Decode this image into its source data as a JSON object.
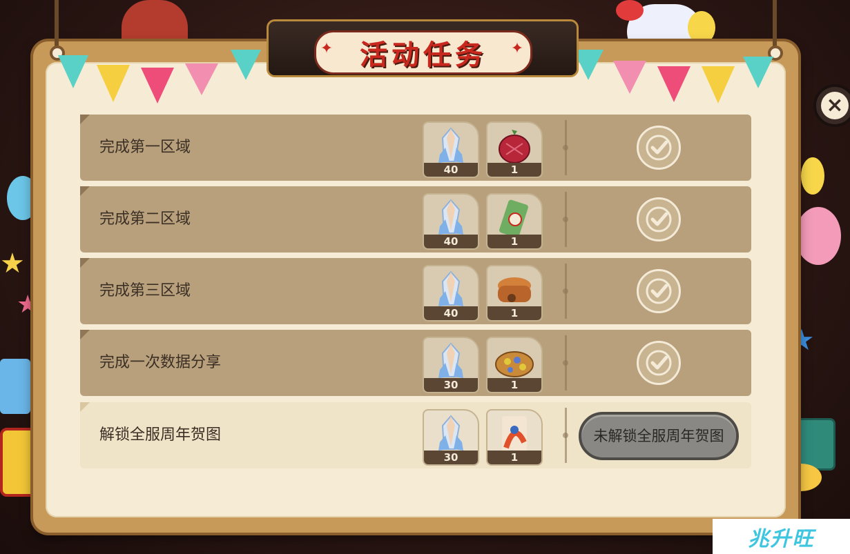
{
  "title": "活动任务",
  "close_icon": "×",
  "tasks": [
    {
      "label": "完成第一区域",
      "rewards": [
        {
          "icon": "crystal-icon",
          "qty": "40"
        },
        {
          "icon": "red-gem-fruit-icon",
          "qty": "1"
        }
      ],
      "status": "claimed"
    },
    {
      "label": "完成第二区域",
      "rewards": [
        {
          "icon": "crystal-icon",
          "qty": "40"
        },
        {
          "icon": "ticket-icon",
          "qty": "1"
        }
      ],
      "status": "claimed"
    },
    {
      "label": "完成第三区域",
      "rewards": [
        {
          "icon": "crystal-icon",
          "qty": "40"
        },
        {
          "icon": "bread-cake-icon",
          "qty": "1"
        }
      ],
      "status": "claimed"
    },
    {
      "label": "完成一次数据分享",
      "rewards": [
        {
          "icon": "crystal-icon",
          "qty": "30"
        },
        {
          "icon": "pie-icon",
          "qty": "1"
        }
      ],
      "status": "claimed"
    },
    {
      "label": "解锁全服周年贺图",
      "rewards": [
        {
          "icon": "crystal-icon",
          "qty": "30"
        },
        {
          "icon": "character-card-icon",
          "qty": "1"
        }
      ],
      "status": "locked",
      "button_label": "未解锁全服周年贺图"
    }
  ],
  "watermark": "兆升旺",
  "colors": {
    "row_done": "#b8a07c",
    "row_pending": "#efe3c8",
    "title_red": "#c8281e",
    "locked_button": "#8a8884"
  }
}
